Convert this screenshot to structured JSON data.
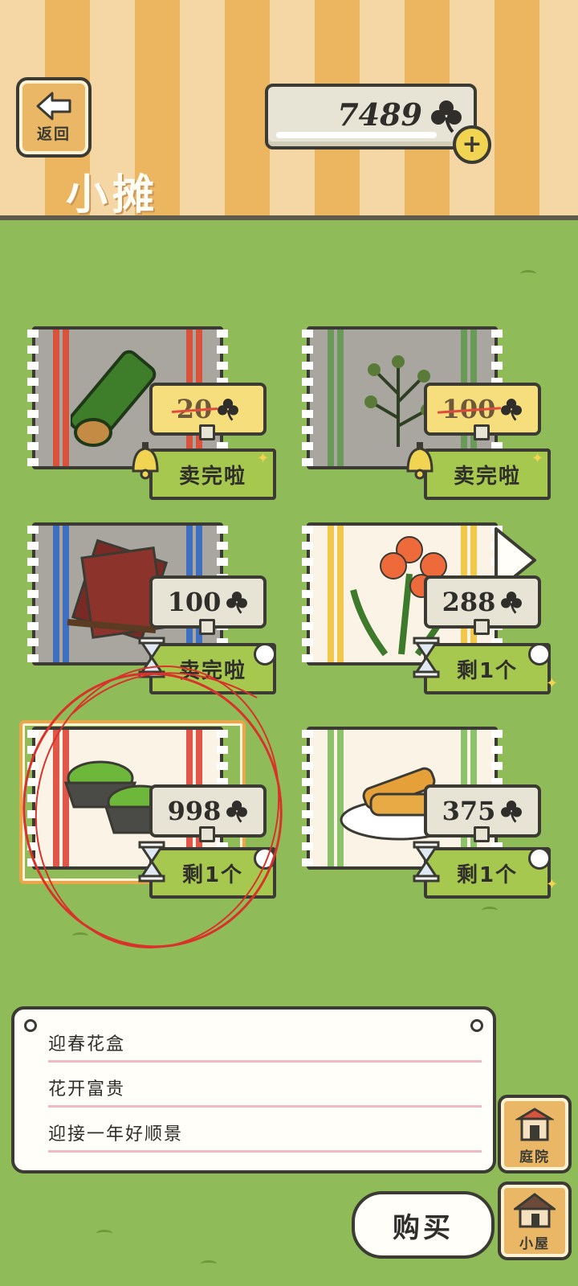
{
  "header": {
    "back_label": "返回",
    "coin_count": "7489",
    "title": "小摊"
  },
  "items": [
    {
      "name": "bamboo",
      "price": "20",
      "sold": true,
      "status": "卖完啦",
      "status_icon": "bell-icon"
    },
    {
      "name": "herb",
      "price": "100",
      "sold": true,
      "status": "卖完啦",
      "status_icon": "bell-icon"
    },
    {
      "name": "calligraphy",
      "price": "100",
      "sold": false,
      "status": "卖完啦",
      "status_icon": "hourglass-icon"
    },
    {
      "name": "lily",
      "price": "288",
      "sold": false,
      "status": "剩1个",
      "status_icon": "hourglass-icon"
    },
    {
      "name": "flower-pot",
      "price": "998",
      "sold": false,
      "status": "剩1个",
      "status_icon": "hourglass-icon",
      "selected": true
    },
    {
      "name": "spring-roll",
      "price": "375",
      "sold": false,
      "status": "剩1个",
      "status_icon": "hourglass-icon"
    }
  ],
  "description": {
    "title": "迎春花盒",
    "line2": "花开富贵",
    "line3": "迎接一年好顺景"
  },
  "buttons": {
    "buy": "购买",
    "yard": "庭院",
    "house": "小屋"
  },
  "colors": {
    "field": "#8fbc58",
    "banner": "#a7c84e",
    "price_tag": "#e7e4d6",
    "sold_tag": "#f6de7d",
    "outline": "#3b3a33",
    "highlight_circle": "#d9322a"
  }
}
